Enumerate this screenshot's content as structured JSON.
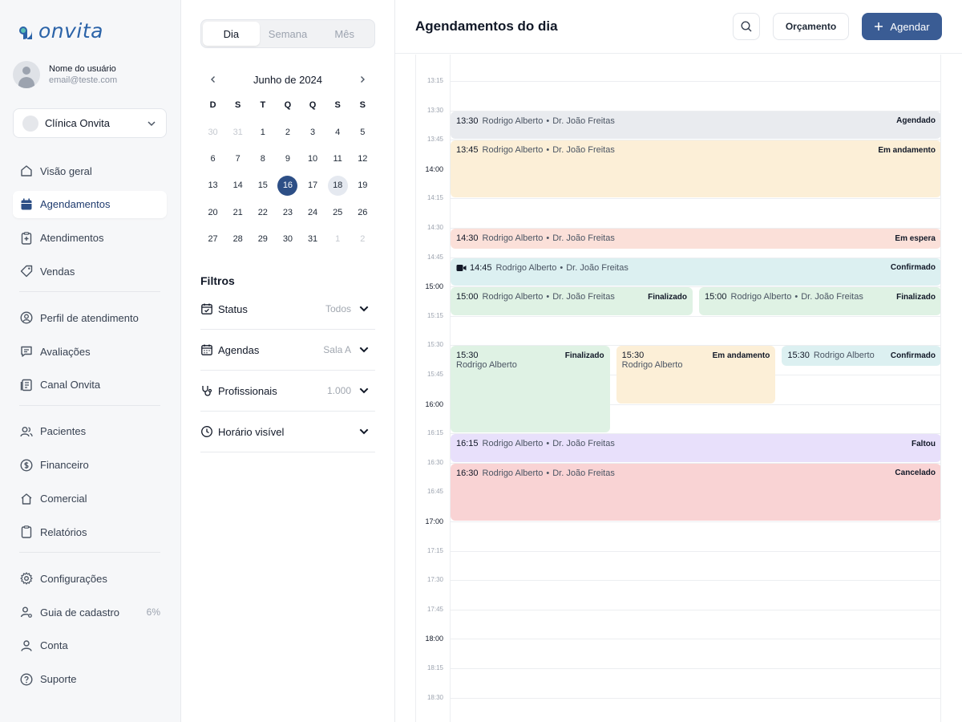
{
  "app": {
    "logo_text": "onvita",
    "brand_color": "#2b63a8",
    "primary_color": "#3a5c94"
  },
  "user": {
    "name": "Nome do usuário",
    "email": "email@teste.com"
  },
  "clinic": {
    "name": "Clínica Onvita"
  },
  "nav": {
    "items": [
      {
        "label": "Visão geral",
        "icon": "home-icon"
      },
      {
        "label": "Agendamentos",
        "icon": "calendar-icon",
        "active": true
      },
      {
        "label": "Atendimentos",
        "icon": "clipboard-plus-icon"
      },
      {
        "label": "Vendas",
        "icon": "tag-icon"
      },
      {
        "label": "Perfil de atendimento",
        "icon": "user-circle-icon"
      },
      {
        "label": "Avaliações",
        "icon": "chat-icon"
      },
      {
        "label": "Canal Onvita",
        "icon": "document-icon"
      },
      {
        "label": "Pacientes",
        "icon": "users-icon"
      },
      {
        "label": "Financeiro",
        "icon": "dollar-icon"
      },
      {
        "label": "Comercial",
        "icon": "storefront-icon"
      },
      {
        "label": "Relatórios",
        "icon": "clipboard-icon"
      },
      {
        "label": "Configurações",
        "icon": "gear-icon"
      },
      {
        "label": "Guia de cadastro",
        "icon": "user-settings-icon",
        "badge": "6%"
      },
      {
        "label": "Conta",
        "icon": "user-icon"
      },
      {
        "label": "Suporte",
        "icon": "help-icon"
      }
    ]
  },
  "view_tabs": [
    "Dia",
    "Semana",
    "Mês"
  ],
  "calendar": {
    "title": "Junho de 2024",
    "weekdays": [
      "D",
      "S",
      "T",
      "Q",
      "Q",
      "S",
      "S"
    ],
    "weeks": [
      [
        "30",
        "31",
        "1",
        "2",
        "3",
        "4",
        "5"
      ],
      [
        "6",
        "7",
        "8",
        "9",
        "10",
        "11",
        "12"
      ],
      [
        "13",
        "14",
        "15",
        "16",
        "17",
        "18",
        "19"
      ],
      [
        "20",
        "21",
        "22",
        "23",
        "24",
        "25",
        "26"
      ],
      [
        "27",
        "28",
        "29",
        "30",
        "31",
        "1",
        "2"
      ]
    ],
    "selected": "16",
    "highlighted": "18"
  },
  "filters": {
    "title": "Filtros",
    "items": [
      {
        "label": "Status",
        "value": "Todos",
        "icon": "calendar-check-icon"
      },
      {
        "label": "Agendas",
        "value": "Sala A",
        "icon": "calendar-grid-icon"
      },
      {
        "label": "Profissionais",
        "value": "1.000",
        "icon": "stethoscope-icon"
      },
      {
        "label": "Horário visível",
        "value": "",
        "icon": "clock-icon"
      }
    ]
  },
  "header": {
    "title": "Agendamentos do dia",
    "budget_label": "Orçamento",
    "schedule_label": "Agendar"
  },
  "timeline": {
    "labels": [
      "13:15",
      "13:30",
      "13:45",
      "14:00",
      "14:15",
      "14:30",
      "14:45",
      "15:00",
      "15:15",
      "15:30",
      "15:45",
      "16:00",
      "16:15",
      "16:30",
      "16:45",
      "17:00",
      "17:15",
      "17:30",
      "17:45",
      "18:00",
      "18:15",
      "18:30"
    ],
    "hours": [
      "14:00",
      "15:00",
      "16:00",
      "17:00",
      "18:00"
    ]
  },
  "status_colors": {
    "Agendado": "#e9ebef",
    "Em andamento": "#fcefd7",
    "Em espera": "#fbe0d9",
    "Confirmado": "#dcf0f1",
    "Finalizado": "#dff2e4",
    "Faltou": "#e8e0fb",
    "Cancelado": "#f9d3d4"
  },
  "events": [
    {
      "time": "13:30",
      "patient": "Rodrigo Alberto",
      "doctor": "Dr. João Freitas",
      "status": "Agendado",
      "start": "13:30",
      "end": "13:45",
      "col": 0,
      "cols": 1
    },
    {
      "time": "13:45",
      "patient": "Rodrigo Alberto",
      "doctor": "Dr. João Freitas",
      "status": "Em andamento",
      "start": "13:45",
      "end": "14:15",
      "col": 0,
      "cols": 1
    },
    {
      "time": "14:30",
      "patient": "Rodrigo Alberto",
      "doctor": "Dr. João Freitas",
      "status": "Em espera",
      "start": "14:30",
      "end": "14:41",
      "col": 0,
      "cols": 1
    },
    {
      "time": "14:45",
      "patient": "Rodrigo Alberto",
      "doctor": "Dr. João Freitas",
      "status": "Confirmado",
      "start": "14:45",
      "end": "15:00",
      "col": 0,
      "cols": 1,
      "video": true
    },
    {
      "time": "15:00",
      "patient": "Rodrigo Alberto",
      "doctor": "Dr. João Freitas",
      "status": "Finalizado",
      "start": "15:00",
      "end": "15:15",
      "col": 0,
      "cols": 2
    },
    {
      "time": "15:00",
      "patient": "Rodrigo Alberto",
      "doctor": "Dr. João Freitas",
      "status": "Finalizado",
      "start": "15:00",
      "end": "15:15",
      "col": 1,
      "cols": 2
    },
    {
      "time": "15:30",
      "patient": "Rodrigo Alberto",
      "doctor": "",
      "status": "Finalizado",
      "start": "15:30",
      "end": "16:15",
      "col": 0,
      "cols": 3,
      "stacked": true
    },
    {
      "time": "15:30",
      "patient": "Rodrigo Alberto",
      "doctor": "",
      "status": "Em andamento",
      "start": "15:30",
      "end": "16:00",
      "col": 1,
      "cols": 3,
      "stacked": true
    },
    {
      "time": "15:30",
      "patient": "Rodrigo Alberto",
      "doctor": "",
      "status": "Confirmado",
      "start": "15:30",
      "end": "15:41",
      "col": 2,
      "cols": 3
    },
    {
      "time": "16:15",
      "patient": "Rodrigo Alberto",
      "doctor": "Dr. João Freitas",
      "status": "Faltou",
      "start": "16:15",
      "end": "16:30",
      "col": 0,
      "cols": 1
    },
    {
      "time": "16:30",
      "patient": "Rodrigo Alberto",
      "doctor": "Dr. João Freitas",
      "status": "Cancelado",
      "start": "16:30",
      "end": "17:00",
      "col": 0,
      "cols": 1
    }
  ]
}
